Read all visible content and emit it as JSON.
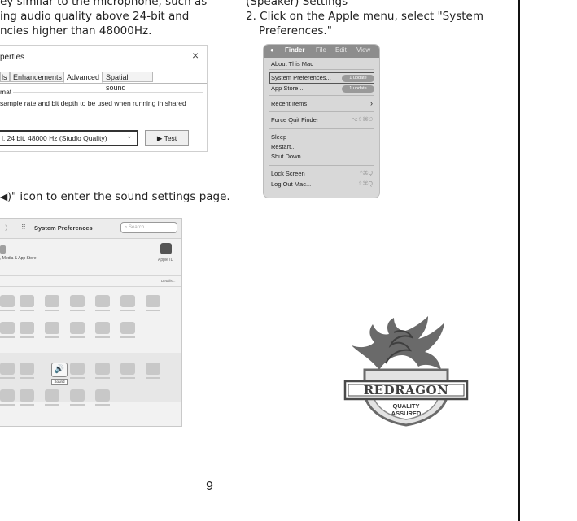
{
  "left_column": {
    "top_lines": [
      "ey similar to the microphone, such as",
      "ing audio quality above 24-bit and",
      "ncies higher than 48000Hz."
    ],
    "sound_icon_text": "\" icon to enter the sound settings page."
  },
  "win_dialog": {
    "title": "perties",
    "close": "×",
    "tabs": [
      "ls",
      "Enhancements",
      "Advanced",
      "Spatial sound"
    ],
    "format_label": "mat",
    "format_desc": "sample rate and bit depth to be used when running in shared",
    "format_value": "l, 24 bit, 48000 Hz (Studio Quality)",
    "test_label": "Test"
  },
  "sys_prefs": {
    "title": "System Preferences",
    "search_placeholder": "Search",
    "account_text": ", Media & App Store",
    "apple_id": "Apple ID",
    "details": "Details...",
    "sound_label": "Sound"
  },
  "right_column": {
    "lines": [
      "(Speaker) Settings",
      "2. Click on the Apple menu, select \"System",
      "Preferences.\""
    ]
  },
  "finder_menu": {
    "menubar": {
      "finder": "Finder",
      "file": "File",
      "edit": "Edit",
      "view": "View"
    },
    "items": {
      "about": "About This Mac",
      "system_prefs": "System Preferences...",
      "system_prefs_badge": "1 update",
      "app_store": "App Store...",
      "app_store_badge": "1 update",
      "recent": "Recent Items",
      "recent_arrow": "›",
      "force_quit": "Force Quit Finder",
      "force_quit_shortcut": "⌥⇧⌘⎋",
      "sleep": "Sleep",
      "restart": "Restart...",
      "shutdown": "Shut Down...",
      "lock": "Lock Screen",
      "lock_shortcut": "^⌘Q",
      "logout": "Log Out Mac...",
      "logout_shortcut": "⇧⌘Q"
    }
  },
  "badge": {
    "brand": "REDRAGON",
    "line1": "QUALITY",
    "line2": "ASSURED",
    "colors": {
      "dark": "#5a5a5a",
      "mid": "#8a8a8a",
      "light": "#d6d6d6"
    }
  },
  "page_number": "9"
}
